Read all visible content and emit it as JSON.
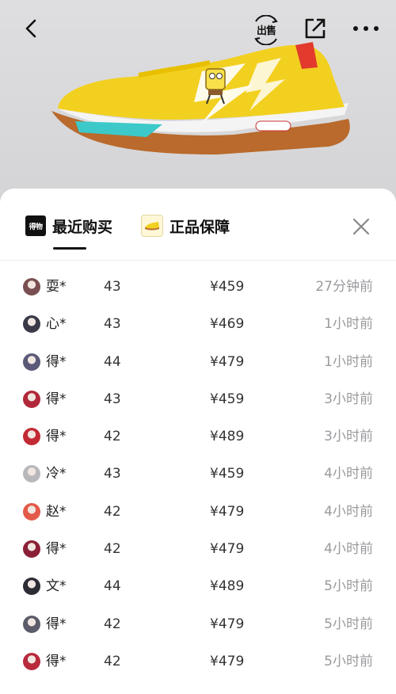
{
  "header": {
    "back_icon": "chevron-left-icon",
    "sell_label": "出售",
    "share_icon": "share-icon",
    "more_icon": "more-horizontal-icon"
  },
  "product_image": "yellow-basketball-shoe-with-cartoon-sponge-character",
  "tabs": [
    {
      "label": "最近购买",
      "logo_text": "得物",
      "active": true
    },
    {
      "label": "正品保障",
      "active": false
    }
  ],
  "colors": {
    "accent": "#111111",
    "time_text": "#9a9a9e"
  },
  "records": [
    {
      "name": "耍*",
      "size": "43",
      "price": "¥459",
      "time": "27分钟前",
      "avatar": "#7a4f52"
    },
    {
      "name": "心*",
      "size": "43",
      "price": "¥469",
      "time": "1小时前",
      "avatar": "#3a3a48"
    },
    {
      "name": "得*",
      "size": "44",
      "price": "¥479",
      "time": "1小时前",
      "avatar": "#5a5a78"
    },
    {
      "name": "得*",
      "size": "43",
      "price": "¥459",
      "time": "3小时前",
      "avatar": "#b0283a"
    },
    {
      "name": "得*",
      "size": "42",
      "price": "¥489",
      "time": "3小时前",
      "avatar": "#c22a34"
    },
    {
      "name": "冷*",
      "size": "43",
      "price": "¥459",
      "time": "4小时前",
      "avatar": "#b8b8bc"
    },
    {
      "name": "赵*",
      "size": "42",
      "price": "¥479",
      "time": "4小时前",
      "avatar": "#e45a48"
    },
    {
      "name": "得*",
      "size": "42",
      "price": "¥479",
      "time": "4小时前",
      "avatar": "#8a2036"
    },
    {
      "name": "文*",
      "size": "44",
      "price": "¥489",
      "time": "5小时前",
      "avatar": "#2c2c34"
    },
    {
      "name": "得*",
      "size": "42",
      "price": "¥479",
      "time": "5小时前",
      "avatar": "#5c5c6a"
    },
    {
      "name": "得*",
      "size": "42",
      "price": "¥479",
      "time": "5小时前",
      "avatar": "#b82a3c"
    }
  ]
}
